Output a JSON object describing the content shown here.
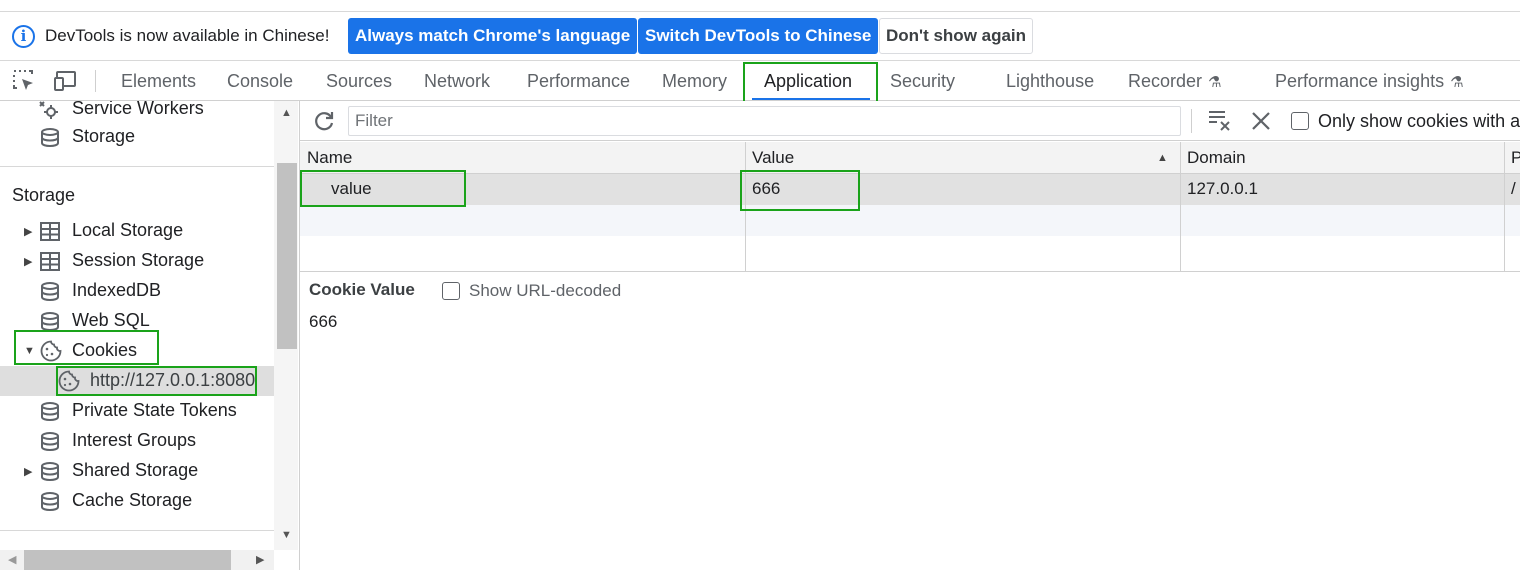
{
  "infobar": {
    "message": "DevTools is now available in Chinese!",
    "btn_match": "Always match Chrome's language",
    "btn_switch": "Switch DevTools to Chinese",
    "btn_dismiss": "Don't show again",
    "info_icon_glyph": "i"
  },
  "tabs": {
    "elements": "Elements",
    "console": "Console",
    "sources": "Sources",
    "network": "Network",
    "performance": "Performance",
    "memory": "Memory",
    "application": "Application",
    "security": "Security",
    "lighthouse": "Lighthouse",
    "recorder": "Recorder",
    "performance_insights": "Performance insights",
    "active": "Application",
    "flask_glyph": "⚗"
  },
  "sidebar": {
    "service_workers": "Service Workers",
    "storage_top": "Storage",
    "section_storage": "Storage",
    "local_storage": "Local Storage",
    "session_storage": "Session Storage",
    "indexeddb": "IndexedDB",
    "web_sql": "Web SQL",
    "cookies": "Cookies",
    "cookie_origin": "http://127.0.0.1:8080",
    "private_state_tokens": "Private State Tokens",
    "interest_groups": "Interest Groups",
    "shared_storage": "Shared Storage",
    "cache_storage": "Cache Storage"
  },
  "toolbar": {
    "filter_placeholder": "Filter",
    "only_show_label": "Only show cookies with a"
  },
  "table": {
    "columns": [
      "Name",
      "Value",
      "Domain",
      "P"
    ],
    "sorted_column": "Value",
    "rows": [
      {
        "name": "value",
        "value": "666",
        "domain": "127.0.0.1",
        "path": "/"
      }
    ]
  },
  "cookie_value": {
    "title": "Cookie Value",
    "show_decoded_label": "Show URL-decoded",
    "value": "666"
  },
  "colors": {
    "accent": "#1a73e8",
    "highlight": "#1aa31a",
    "selection": "#dedede"
  }
}
